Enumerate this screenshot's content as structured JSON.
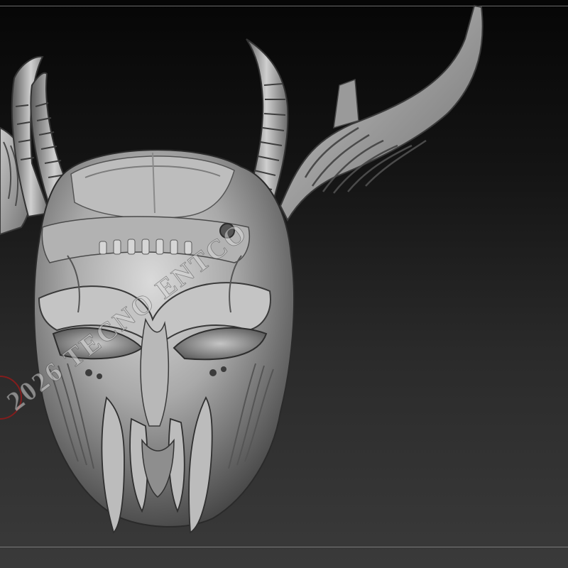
{
  "viewport": {
    "background_top": "#060606",
    "background_bottom": "#3a3a3a",
    "model_color": "#b4b4b4"
  },
  "watermark": {
    "text": "2026 TECNO ENTCO",
    "stamp_color": "#a01818"
  }
}
